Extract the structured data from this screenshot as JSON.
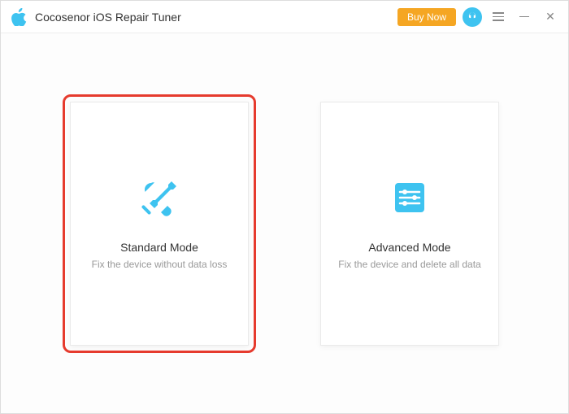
{
  "header": {
    "app_title": "Cocosenor iOS Repair Tuner",
    "buy_label": "Buy Now"
  },
  "modes": {
    "standard": {
      "title": "Standard Mode",
      "subtitle": "Fix the device without data loss"
    },
    "advanced": {
      "title": "Advanced Mode",
      "subtitle": "Fix the device and delete all data"
    }
  },
  "colors": {
    "accent": "#3ec3f0",
    "highlight": "#e63b2e",
    "buy": "#f5a623"
  }
}
